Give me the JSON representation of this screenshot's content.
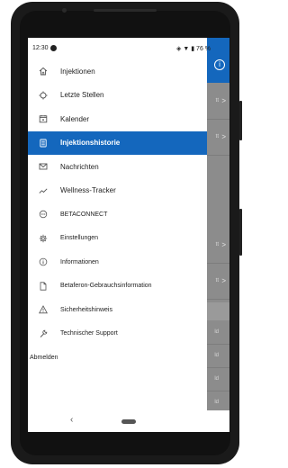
{
  "status_bar": {
    "time": "12:30",
    "battery": "76 %"
  },
  "menu": {
    "items": [
      {
        "label": "Injektionen",
        "icon": "home-icon"
      },
      {
        "label": "Letzte Stellen",
        "icon": "crosshair-icon"
      },
      {
        "label": "Kalender",
        "icon": "calendar-icon"
      },
      {
        "label": "Injektionshistorie",
        "icon": "history-icon",
        "active": true
      },
      {
        "label": "Nachrichten",
        "icon": "mail-icon"
      },
      {
        "label": "Wellness-Tracker",
        "icon": "trend-icon"
      },
      {
        "label": "BETACONNECT",
        "icon": "connect-icon"
      },
      {
        "label": "Einstellungen",
        "icon": "gear-icon"
      },
      {
        "label": "Informationen",
        "icon": "info-icon"
      },
      {
        "label": "Betaferon-Gebrauchsinformation",
        "icon": "document-icon"
      },
      {
        "label": "Sicherheitshinweis",
        "icon": "warning-icon"
      },
      {
        "label": "Technischer Support",
        "icon": "wrench-icon"
      },
      {
        "label": "Abmelden"
      }
    ]
  },
  "accent_color": "#1467bd"
}
